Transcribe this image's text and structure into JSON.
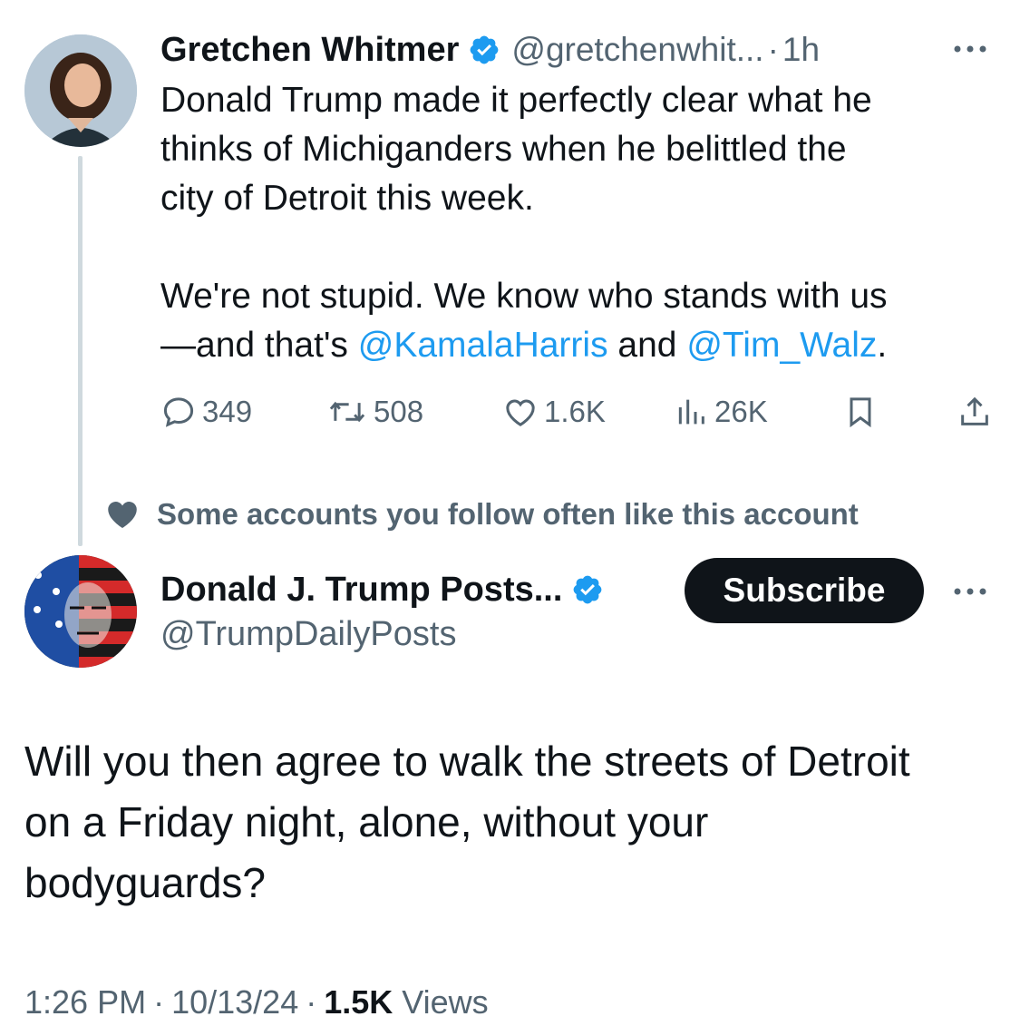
{
  "tweet1": {
    "author_name": "Gretchen Whitmer",
    "handle": "@gretchenwhit...",
    "dot": "·",
    "time": "1h",
    "lines": [
      "Donald Trump made it perfectly clear what he",
      "thinks of Michiganders when he belittled the",
      "city of Detroit this week."
    ],
    "line4": "We're not stupid. We know who stands with us",
    "line5_prefix": "—and that's ",
    "mention1": "@KamalaHarris",
    "line5_mid": " and ",
    "mention2": "@Tim_Walz",
    "line5_suffix": ".",
    "replies": "349",
    "reposts": "508",
    "likes": "1.6K",
    "views": "26K"
  },
  "social_context": {
    "text": "Some accounts you follow often like this account"
  },
  "tweet2": {
    "author_name": "Donald J. Trump Posts...",
    "handle": "@TrumpDailyPosts",
    "subscribe_label": "Subscribe",
    "lines": [
      "Will you then agree to walk the streets of Detroit",
      "on a Friday night, alone, without your",
      "bodyguards?"
    ],
    "time": "1:26 PM",
    "date": "10/13/24",
    "views_count": "1.5K",
    "views_label": "Views",
    "sep": "·"
  },
  "colors": {
    "text": "#0f1419",
    "secondary": "#536471",
    "link": "#1d9bf0",
    "verified": "#1d9bf0",
    "thread_line": "#cfd9de",
    "button": "#0f1419"
  },
  "icons": [
    "verified-badge-icon",
    "more-icon",
    "reply-icon",
    "repost-icon",
    "like-icon",
    "views-icon",
    "bookmark-icon",
    "share-icon",
    "heart-icon"
  ]
}
